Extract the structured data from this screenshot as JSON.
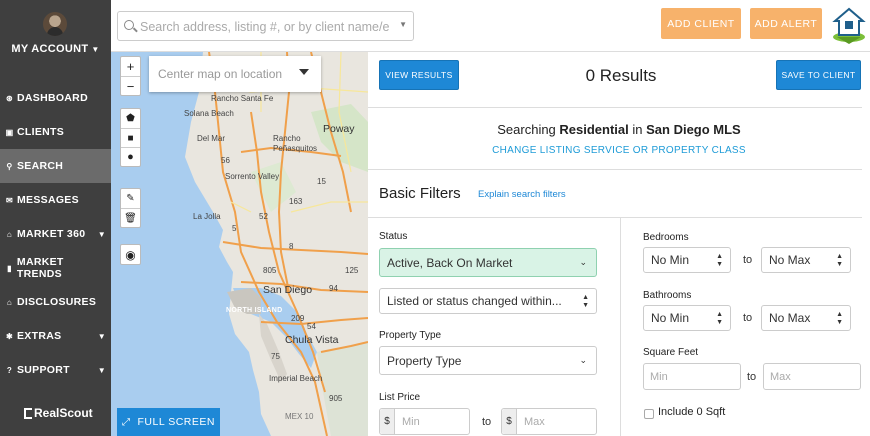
{
  "sidebar": {
    "account_label": "MY ACCOUNT",
    "items": [
      {
        "label": "DASHBOARD",
        "icon": "dashboard-icon",
        "glyph": "⊛",
        "caret": false
      },
      {
        "label": "CLIENTS",
        "icon": "clients-icon",
        "glyph": "▣",
        "caret": false
      },
      {
        "label": "SEARCH",
        "icon": "location-pin-icon",
        "glyph": "⚲",
        "caret": false,
        "active": true
      },
      {
        "label": "MESSAGES",
        "icon": "envelope-icon",
        "glyph": "✉",
        "caret": false
      },
      {
        "label": "MARKET 360",
        "icon": "home-icon",
        "glyph": "⌂",
        "caret": true
      },
      {
        "label": "MARKET TRENDS",
        "icon": "bar-chart-icon",
        "glyph": "▮",
        "caret": false
      },
      {
        "label": "DISCLOSURES",
        "icon": "home-icon",
        "glyph": "⌂",
        "caret": false
      },
      {
        "label": "EXTRAS",
        "icon": "gear-icon",
        "glyph": "✱",
        "caret": true
      },
      {
        "label": "SUPPORT",
        "icon": "question-icon",
        "glyph": "?",
        "caret": true
      }
    ],
    "brand": "RealScout"
  },
  "topbar": {
    "search_placeholder": "Search address, listing #, or by client name/emai",
    "add_client": "ADD CLIENT",
    "add_alert": "ADD ALERT"
  },
  "map": {
    "center_placeholder": "Center map on location",
    "zoom_in": "+",
    "zoom_out": "−",
    "labels": {
      "rancho_santa_fe": "Rancho Santa Fe",
      "solana_beach": "Solana Beach",
      "del_mar": "Del Mar",
      "rancho_penasquitos": "Rancho\nPeñasquitos",
      "poway": "Poway",
      "sorrento_valley": "Sorrento Valley",
      "la_jolla": "La Jolla",
      "san_diego": "San Diego",
      "north_island": "NORTH ISLAND",
      "chula_vista": "Chula Vista",
      "imperial_beach": "Imperial Beach",
      "mex": "MEX 10",
      "hwy56": "56",
      "hwy163": "163",
      "hwy15": "15",
      "hwy5": "5",
      "hwy805": "805",
      "hwy52": "52",
      "hwy8": "8",
      "hwy94": "94",
      "hwy54": "54",
      "hwy125": "125",
      "hwy905": "905",
      "hwy75": "75",
      "hwy209": "209"
    },
    "fullscreen": "FULL SCREEN"
  },
  "results": {
    "view_results": "VIEW RESULTS",
    "count": "0 Results",
    "save_to_client": "SAVE TO CLIENT",
    "searching_prefix": "Searching ",
    "property_class": "Residential",
    "searching_in": " in ",
    "mls": "San Diego MLS",
    "change_link": "CHANGE LISTING SERVICE OR PROPERTY CLASS",
    "basic_filters": "Basic Filters",
    "explain_link": "Explain search filters"
  },
  "filters": {
    "status_label": "Status",
    "status_value": "Active, Back On Market",
    "listed_changed": "Listed or status changed within...",
    "property_type_label": "Property Type",
    "property_type_value": "Property Type",
    "list_price_label": "List Price",
    "currency": "$",
    "min_placeholder": "Min",
    "max_placeholder": "Max",
    "to": "to",
    "bedrooms_label": "Bedrooms",
    "bedrooms_min": "No Min",
    "bedrooms_max": "No Max",
    "bathrooms_label": "Bathrooms",
    "bathrooms_min": "No Min",
    "bathrooms_max": "No Max",
    "square_feet_label": "Square Feet",
    "include_zero_sqft": "Include 0 Sqft"
  },
  "colors": {
    "sidebar_bg": "#3f3f3f",
    "active_nav": "#6b6b6b",
    "accent_blue": "#1e88d6",
    "orange": "#f7b26b",
    "status_green": "#d9f3e6"
  }
}
